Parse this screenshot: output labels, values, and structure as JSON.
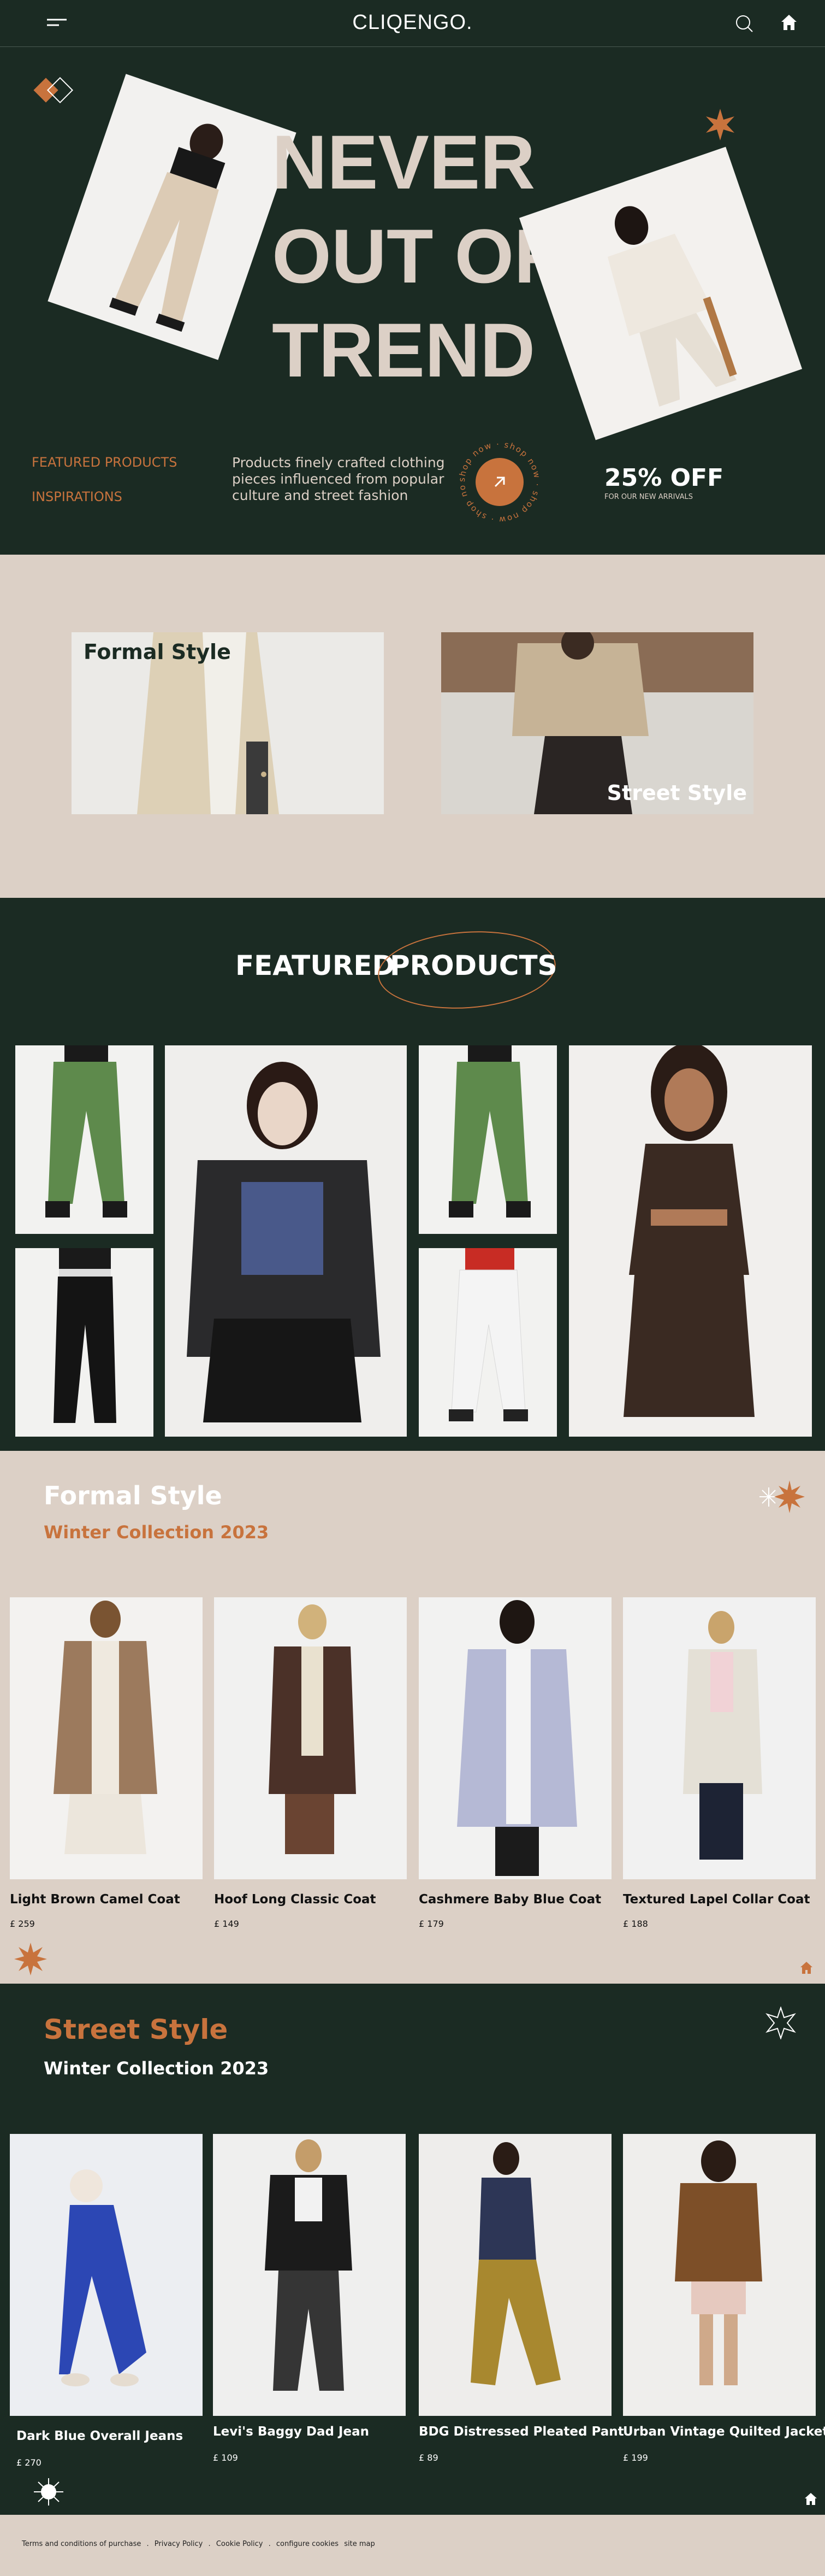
{
  "header": {
    "brand": "CLIQENGO.",
    "menu_icon": "hamburger-menu-icon",
    "search_icon": "search-icon",
    "home_icon": "home-icon"
  },
  "hero": {
    "headline_lines": [
      "NEVER",
      "OUT OF",
      "TREND"
    ],
    "nav_featured": "FEATURED PRODUCTS",
    "nav_inspirations": "INSPIRATIONS",
    "description": [
      "Products finely crafted clothing",
      "pieces influenced from popular",
      "culture and street fashion"
    ],
    "circle_text": "shop now · shop now · shop now · shop now ·",
    "arrow_icon": "arrow-up-right-icon",
    "offer_title": "25% OFF",
    "offer_sub": "FOR OUR NEW ARRIVALS",
    "accent": "#c8733d",
    "headline_color": "#dcd0c6"
  },
  "styles": {
    "formal_label": "Formal Style",
    "street_label": "Street Style"
  },
  "featured": {
    "word1": "FEATURED",
    "word2": "PRODUCTS"
  },
  "formal": {
    "title": "Formal Style",
    "subtitle": "Winter Collection 2023",
    "products": [
      {
        "name": "Light Brown Camel Coat",
        "price": "£ 259"
      },
      {
        "name": "Hoof Long Classic Coat",
        "price": "£ 149"
      },
      {
        "name": "Cashmere Baby Blue Coat",
        "price": "£ 179"
      },
      {
        "name": "Textured Lapel Collar Coat",
        "price": "£ 188"
      }
    ]
  },
  "street": {
    "title": "Street Style",
    "subtitle": "Winter Collection 2023",
    "products": [
      {
        "name": "Dark Blue Overall Jeans",
        "price": "£ 270"
      },
      {
        "name": "Levi's Baggy Dad Jean",
        "price": "£ 109"
      },
      {
        "name": "BDG Distressed Pleated Pant",
        "price": "£ 89"
      },
      {
        "name": "Urban Vintage Quilted Jacket",
        "price": "£ 199"
      }
    ]
  },
  "footer": {
    "links": [
      "Terms and conditions of purchase",
      "Privacy Policy",
      "Cookie Policy",
      "configure cookies",
      "site map"
    ],
    "separators": [
      ".",
      ".",
      "."
    ]
  }
}
